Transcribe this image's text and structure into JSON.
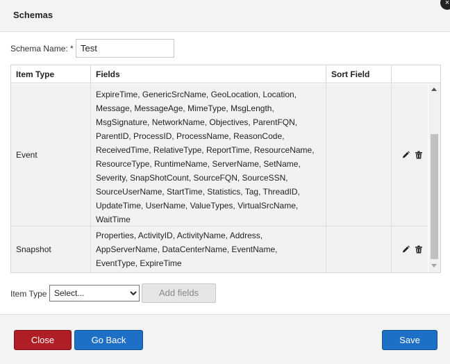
{
  "dialog": {
    "title": "Schemas",
    "close_icon": "×"
  },
  "schema_name": {
    "label": "Schema Name: *",
    "value": "Test"
  },
  "table": {
    "headers": {
      "item_type": "Item Type",
      "fields": "Fields",
      "sort_field": "Sort Field"
    },
    "rows": [
      {
        "item_type": "Event",
        "fields": "ExpireTime, GenericSrcName, GeoLocation, Location, Message, MessageAge, MimeType, MsgLength, MsgSignature, NetworkName, Objectives, ParentFQN, ParentID, ProcessID, ProcessName, ReasonCode, ReceivedTime, RelativeType, ReportTime, ResourceName, ResourceType, RuntimeName, ServerName, SetName, Severity, SnapShotCount, SourceFQN, SourceSSN, SourceUserName, StartTime, Statistics, Tag, ThreadID, UpdateTime, UserName, ValueTypes, VirtualSrcName, WaitTime",
        "sort_field": ""
      },
      {
        "item_type": "Snapshot",
        "fields": "Properties, ActivityID, ActivityName, Address, AppServerName, DataCenterName, EventName, EventType, ExpireTime",
        "sort_field": ""
      }
    ]
  },
  "add_row": {
    "label": "Item Type",
    "select_value": "Select...",
    "add_button": "Add fields"
  },
  "footer": {
    "close": "Close",
    "go_back": "Go Back",
    "save": "Save"
  },
  "colors": {
    "close": "#b01e25",
    "primary": "#1e6fc6"
  }
}
